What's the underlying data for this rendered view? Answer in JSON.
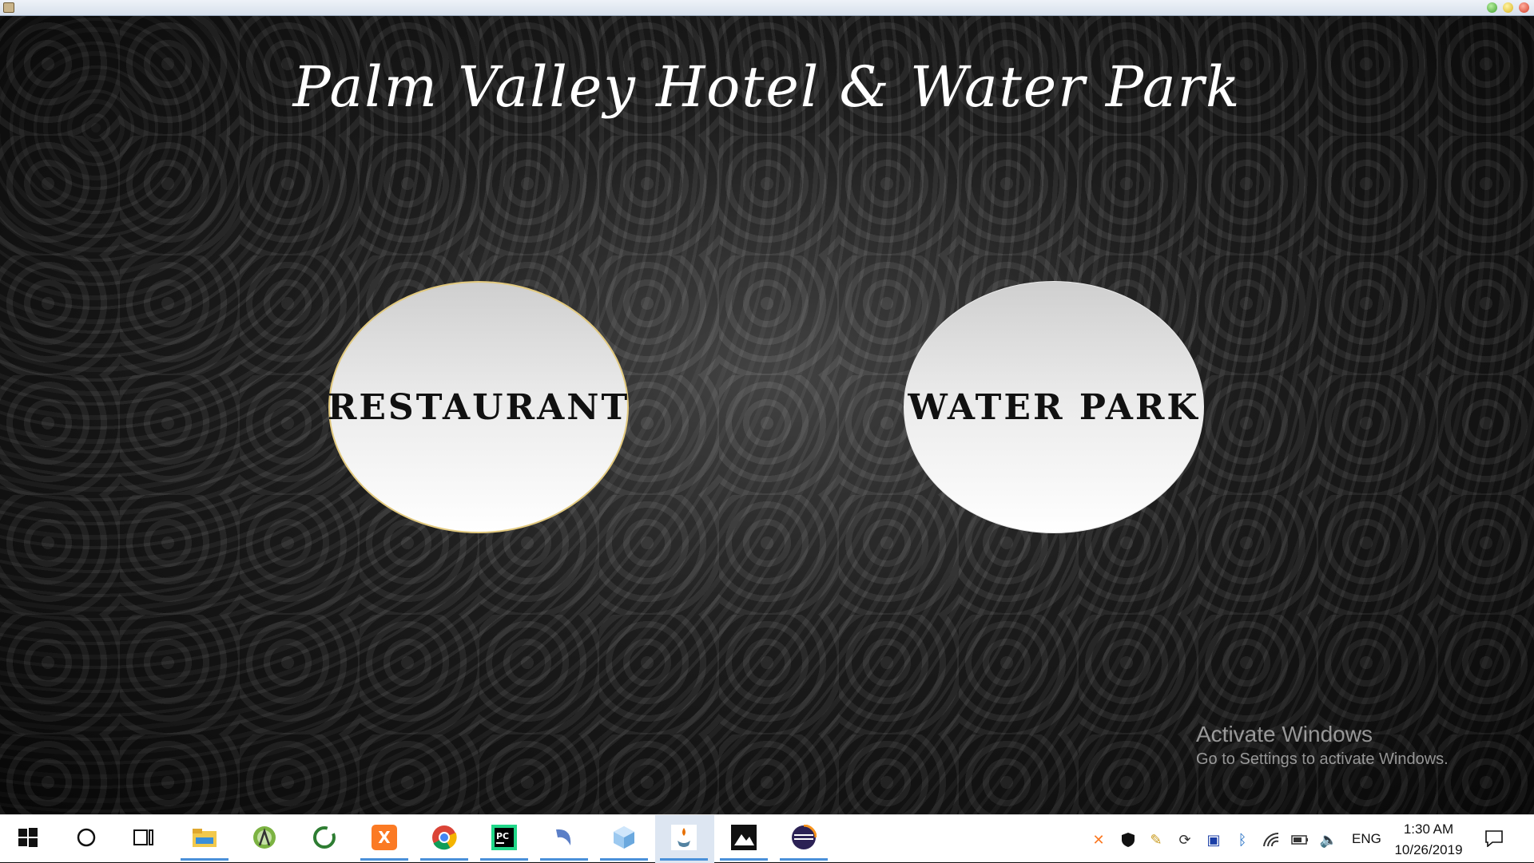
{
  "window": {
    "title_bar_buttons": [
      "minimize",
      "maximize",
      "close"
    ]
  },
  "app": {
    "title": "Palm Valley Hotel & Water Park",
    "buttons": [
      {
        "label": "RESTAURANT"
      },
      {
        "label": "WATER PARK"
      }
    ]
  },
  "watermark": {
    "line1": "Activate Windows",
    "line2": "Go to Settings to activate Windows."
  },
  "taskbar": {
    "apps": [
      "windows-start-icon",
      "search-circle-icon",
      "task-view-icon",
      "file-explorer-icon",
      "android-studio-icon",
      "cycle-app-icon",
      "xampp-icon",
      "chrome-icon",
      "pycharm-icon",
      "dolphin-app-icon",
      "cube-app-icon",
      "java-icon",
      "photos-icon",
      "eclipse-icon"
    ],
    "tray": {
      "icons": [
        "xampp-tray-icon",
        "defender-icon",
        "pen-icon",
        "network-sync-icon",
        "display-icon",
        "bluetooth-icon",
        "wifi-icon",
        "battery-icon",
        "volume-icon"
      ],
      "language": "ENG",
      "time": "1:30 AM",
      "date": "10/26/2019"
    }
  }
}
